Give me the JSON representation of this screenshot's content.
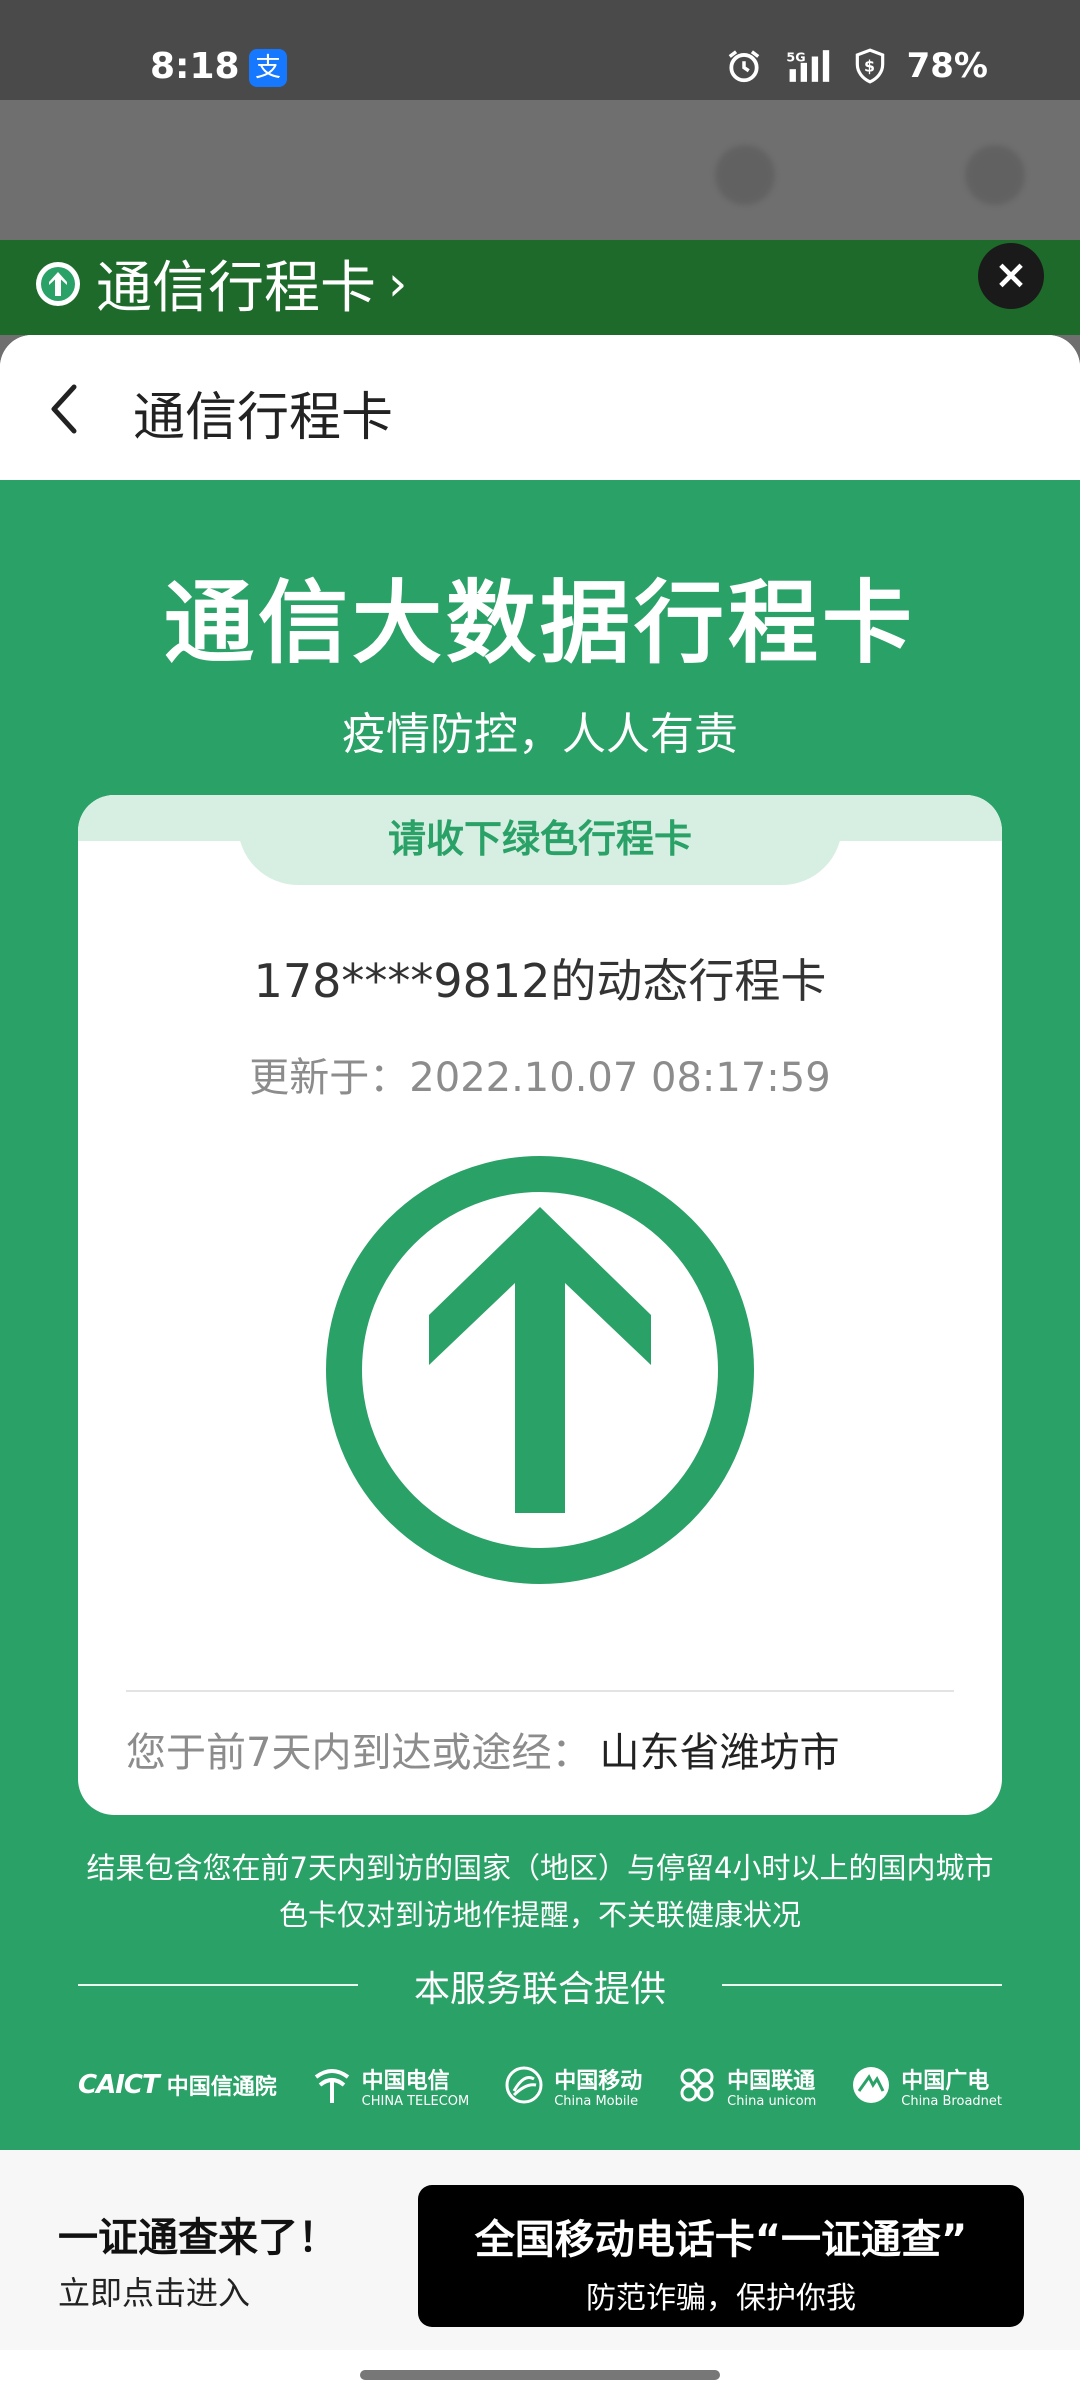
{
  "status_bar": {
    "time": "8:18",
    "network": "5G",
    "battery": "78%"
  },
  "mini_app": {
    "title": "通信行程卡",
    "chevron": "›"
  },
  "nav": {
    "title": "通信行程卡"
  },
  "hero": {
    "title": "通信大数据行程卡",
    "subtitle": "疫情防控，人人有责"
  },
  "card": {
    "tab_label": "请收下绿色行程卡",
    "phone_line": "178****9812的动态行程卡",
    "updated": "更新于：2022.10.07 08:17:59",
    "status_color": "#2aa167",
    "route_label": "您于前7天内到达或途经：",
    "route_city": "山东省潍坊市"
  },
  "notes": {
    "line1": "结果包含您在前7天内到访的国家（地区）与停留4小时以上的国内城市",
    "line2": "色卡仅对到访地作提醒，不关联健康状况"
  },
  "providers": {
    "heading": "本服务联合提供",
    "items": [
      {
        "en": "CAICT",
        "cn": "中国信通院"
      },
      {
        "cn": "中国电信",
        "en": "CHINA TELECOM"
      },
      {
        "cn": "中国移动",
        "en": "China Mobile"
      },
      {
        "cn": "中国联通",
        "en": "China unicom"
      },
      {
        "cn": "中国广电",
        "en": "China Broadnet"
      }
    ]
  },
  "promo": {
    "title": "一证通查来了！",
    "subtitle": "立即点击进入",
    "button_line1": "全国移动电话卡“一证通查”",
    "button_line2": "防范诈骗，保护你我"
  },
  "icons": {
    "alipay": "支",
    "close": "×"
  }
}
